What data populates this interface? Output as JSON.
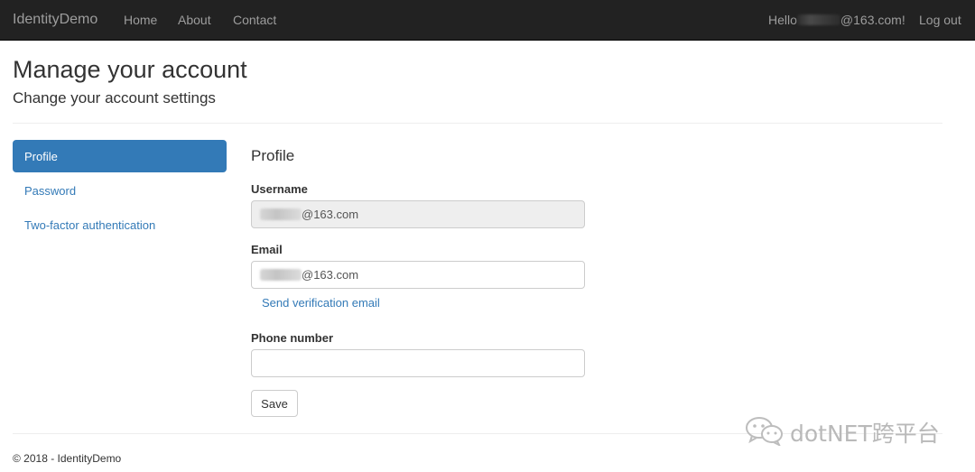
{
  "navbar": {
    "brand": "IdentityDemo",
    "links": [
      "Home",
      "About",
      "Contact"
    ],
    "hello_prefix": "Hello",
    "hello_suffix": "@163.com!",
    "logout": "Log out"
  },
  "header": {
    "title": "Manage your account",
    "subtitle": "Change your account settings"
  },
  "sidebar": {
    "items": [
      {
        "label": "Profile",
        "active": true
      },
      {
        "label": "Password",
        "active": false
      },
      {
        "label": "Two-factor authentication",
        "active": false
      }
    ]
  },
  "form": {
    "section_title": "Profile",
    "username_label": "Username",
    "username_value_suffix": "@163.com",
    "email_label": "Email",
    "email_value_suffix": "@163.com",
    "send_verification": "Send verification email",
    "phone_label": "Phone number",
    "phone_value": "",
    "save_label": "Save"
  },
  "footer": {
    "text": "© 2018 - IdentityDemo"
  },
  "watermark": {
    "text": "dotNET跨平台",
    "icon": "wechat-icon"
  },
  "colors": {
    "navbar_bg": "#222222",
    "accent": "#337ab7",
    "disabled_bg": "#eeeeee"
  }
}
